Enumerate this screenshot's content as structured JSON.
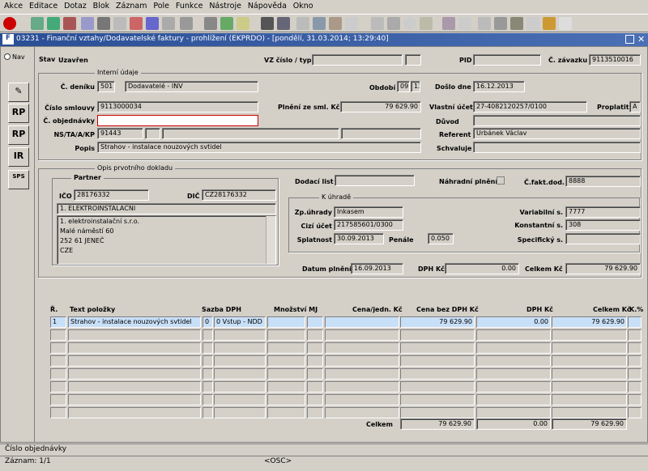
{
  "menu": [
    "Akce",
    "Editace",
    "Dotaz",
    "Blok",
    "Záznam",
    "Pole",
    "Funkce",
    "Nástroje",
    "Nápověda",
    "Okno"
  ],
  "window": {
    "title": "03231 - Finanční vztahy/Dodavatelské faktury - prohlížení (EKPRDO) - [pondělí, 31.03.2014; 13:29:40]"
  },
  "side": {
    "nav": "Nav",
    "buttons": [
      "RP",
      "RP",
      "IR",
      "SPS"
    ]
  },
  "header": {
    "stav_label": "Stav",
    "stav_value": "Uzavřen",
    "vz_label": "VZ číslo / typ",
    "vz_value": "",
    "vz_typ": "",
    "pid_label": "PID",
    "pid_value": "",
    "zavazek_label": "Č. závazku",
    "zavazek_value": "9113510016"
  },
  "internal": {
    "title": "Interní údaje",
    "denik_label": "Č. deníku",
    "denik_value": "501",
    "denik_name": "Dodavatelé - INV",
    "obdobi_label": "Období",
    "obdobi_month": "09",
    "obdobi_year": "13",
    "doslo_label": "Došlo dne",
    "doslo_value": "16.12.2013",
    "smlouva_label": "Číslo smlouvy",
    "smlouva_value": "9113000034",
    "plneni_label": "Plnění ze sml. Kč",
    "plneni_value": "79 629.90",
    "ucet_label": "Vlastní účet",
    "ucet_value": "27-4082120257/0100",
    "proplatit_label": "Proplatit",
    "proplatit_value": "A",
    "objednavka_label": "Č. objednávky",
    "objednavka_value": "",
    "duvod_label": "Důvod",
    "duvod_value": "",
    "ns_label": "NS/TA/A/KP",
    "ns_value": "91443",
    "referent_label": "Referent",
    "referent_value": "Urbánek Václav",
    "popis_label": "Popis",
    "popis_value": "Strahov - instalace nouzových svtidel",
    "schvaluje_label": "Schvaluje",
    "schvaluje_value": ""
  },
  "doklad": {
    "title": "Opis prvotního dokladu",
    "partner_title": "Partner",
    "ico_label": "IČO",
    "ico_value": "28176332",
    "dic_label": "DIČ",
    "dic_value": "CZ28176332",
    "partner_name": "1. ELEKTROINSTALACNI",
    "address": [
      "1. elektroinstalační s.r.o.",
      "Malé náměstí 60",
      "252 61 JENEČ",
      "CZE"
    ],
    "dodaci_label": "Dodací list",
    "dodaci_value": "",
    "nahradni_label": "Náhradní plnění",
    "cfakt_label": "Č.fakt.dod.",
    "cfakt_value": "8888"
  },
  "uhrada": {
    "title": "K úhradě",
    "zp_label": "Zp.úhrady",
    "zp_value": "Inkasem",
    "cizi_label": "Cizí účet",
    "cizi_value": "217585601/0300",
    "splatnost_label": "Splatnost",
    "splatnost_value": "30.09.2013",
    "penale_label": "Penále",
    "penale_value": "0.050",
    "var_label": "Variabilní s.",
    "var_value": "7777",
    "konst_label": "Konstantní s.",
    "konst_value": "308",
    "spec_label": "Specifický s.",
    "spec_value": ""
  },
  "summary": {
    "datum_label": "Datum plnění",
    "datum_value": "16.09.2013",
    "dph_label": "DPH Kč",
    "dph_value": "0.00",
    "celkem_label": "Celkem Kč",
    "celkem_value": "79 629.90"
  },
  "table": {
    "columns": [
      "Ř.",
      "Text položky",
      "Sazba DPH",
      "Množství MJ",
      "Cena/jedn. Kč",
      "Cena bez DPH Kč",
      "DPH Kč",
      "Celkem Kč",
      "K.%"
    ],
    "row1": {
      "r": "1",
      "text": "Strahov - instalace nouzových svtidel",
      "sazba": "0",
      "sazba_text": "0 Vstup - NDD F",
      "mnozstvi": "",
      "mj": "",
      "cena_jedn": "",
      "cena_bez": "79 629.90",
      "dph": "0.00",
      "celkem": "79 629.90",
      "k": ""
    },
    "totals": {
      "label": "Celkem",
      "cena_bez": "79 629.90",
      "dph": "0.00",
      "celkem": "79 629.90"
    }
  },
  "status": {
    "hint": "Číslo objednávky",
    "record": "Záznam: 1/1",
    "osc": "<OSC>"
  }
}
